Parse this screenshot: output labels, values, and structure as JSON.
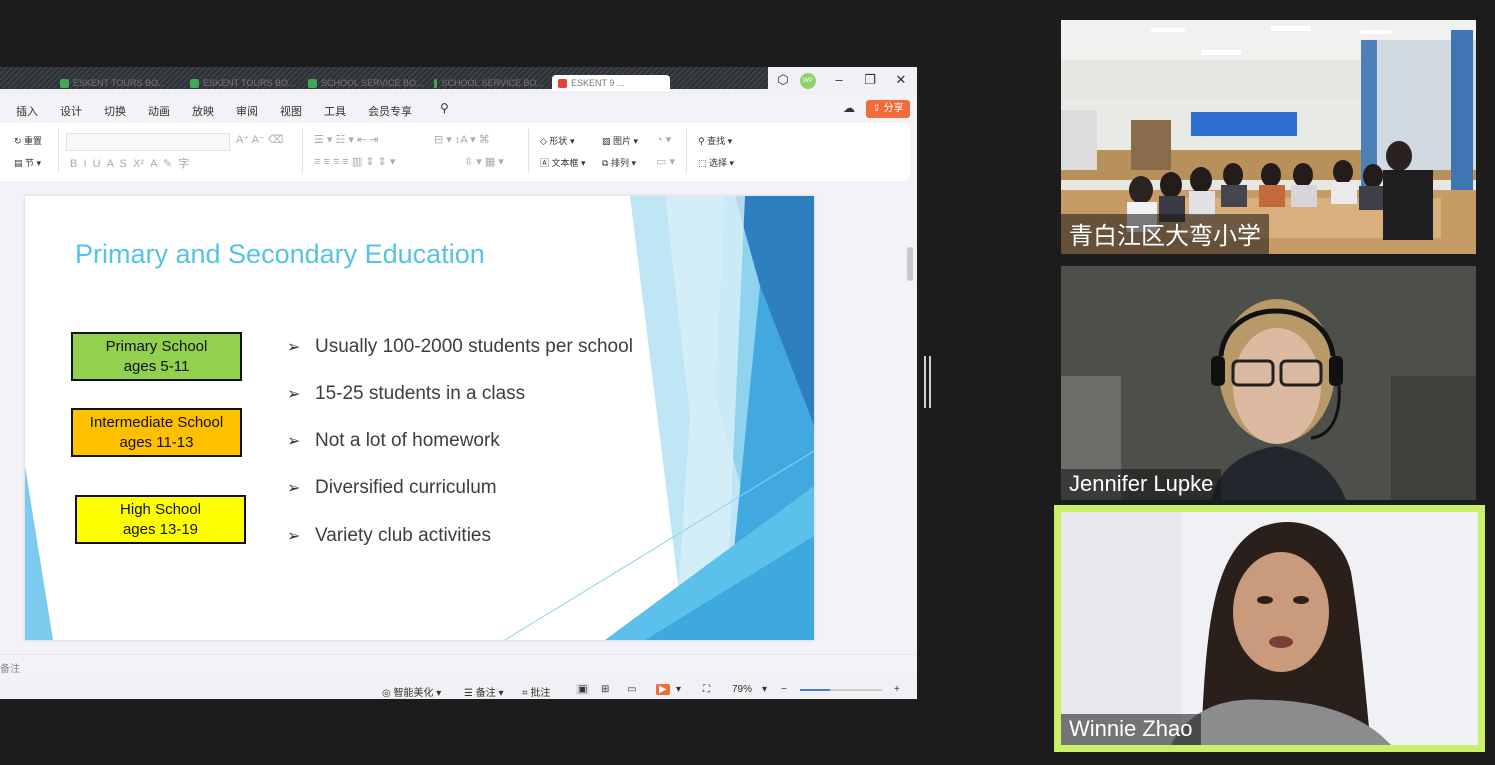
{
  "app": {
    "tabs": [
      "ESKENT TOURS BO...",
      "ESKENT TOURS BO...",
      "SCHOOL SERVICE BO...",
      "SCHOOL SERVICE BO...",
      "ESKENT 9 ..."
    ],
    "avatar_initials": "WP",
    "menu": [
      "插入",
      "设计",
      "切换",
      "动画",
      "放映",
      "审阅",
      "视图",
      "工具",
      "会员专享"
    ],
    "share_label": "分享"
  },
  "ribbon": {
    "redo": "重置",
    "section": "节",
    "shape": "形状",
    "picture": "图片",
    "textbox": "文本框",
    "arrange": "排列",
    "find": "查找",
    "select": "选择"
  },
  "slide": {
    "title": "Primary and Secondary Education",
    "boxes": [
      {
        "line1": "Primary School",
        "line2": "ages 5-11",
        "color": "#92d050"
      },
      {
        "line1": "Intermediate School",
        "line2": "ages 11-13",
        "color": "#ffc000"
      },
      {
        "line1": "High School",
        "line2": "ages 13-19",
        "color": "#ffff00"
      }
    ],
    "bullets": [
      "Usually 100-2000 students per school",
      "15-25 students in a class",
      "Not a lot of homework",
      "Diversified curriculum",
      "Variety club activities"
    ]
  },
  "notes_label": "备注",
  "status": {
    "beautify": "智能美化",
    "notes": "备注",
    "comments": "批注",
    "zoom": "79%"
  },
  "participants": [
    {
      "name": "青白江区大弯小学",
      "active": false
    },
    {
      "name": "Jennifer Lupke",
      "active": false
    },
    {
      "name": "Winnie Zhao",
      "active": true
    }
  ],
  "colors": {
    "accent_title": "#55c2e6",
    "active_speaker_border": "#c8f06a",
    "share_button": "#f26b3a"
  }
}
